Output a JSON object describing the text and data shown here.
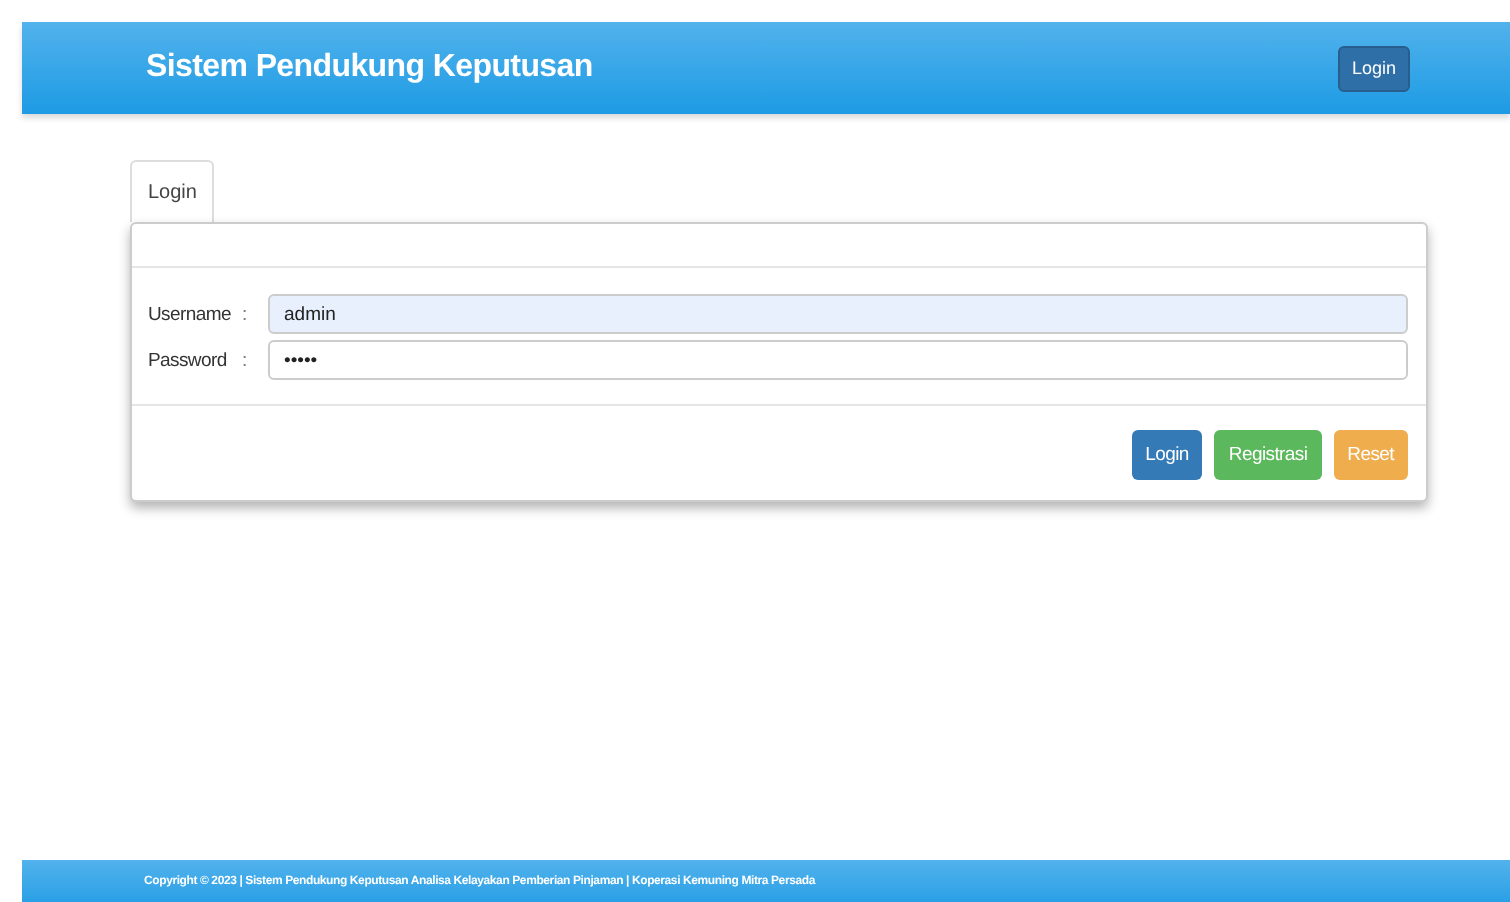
{
  "navbar": {
    "title": "Sistem Pendukung Keputusan",
    "button": "Login"
  },
  "tabs": [
    {
      "label": "Login",
      "selected": true
    }
  ],
  "form": {
    "fields": [
      {
        "label": "Username",
        "separator": ":",
        "value": "admin",
        "autofilled": true
      },
      {
        "label": "Password",
        "separator": ":",
        "value": "•••••",
        "autofilled": false
      }
    ],
    "buttons": [
      {
        "label": "Login",
        "color": "#337ab7"
      },
      {
        "label": "Registrasi",
        "color": "#5cb85c"
      },
      {
        "label": "Reset",
        "color": "#f0ad4e"
      }
    ]
  },
  "footer": "Copyright © 2023 | Sistem Pendukung Keputusan Analisa Kelayakan Pemberian Pinjaman | Koperasi Kemuning Mitra Persada"
}
